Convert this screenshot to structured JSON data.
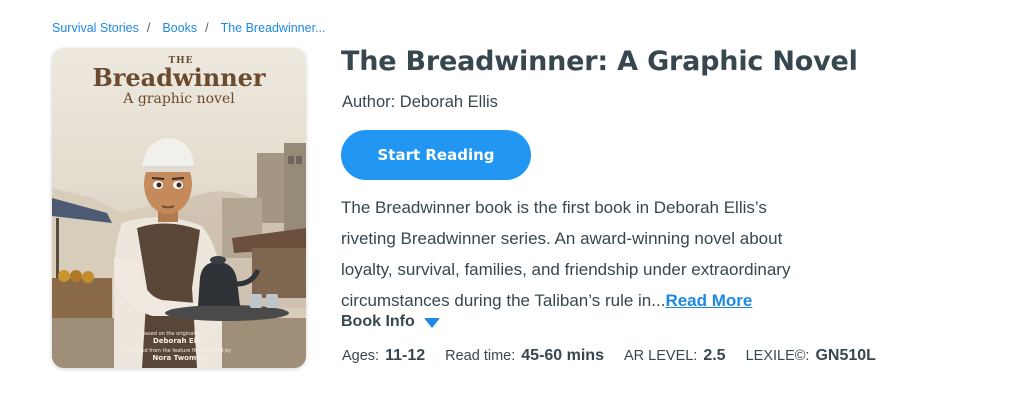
{
  "breadcrumb": [
    {
      "label": "Survival Stories"
    },
    {
      "label": "Books"
    },
    {
      "label": "The Breadwinner..."
    }
  ],
  "cover": {
    "title_small": "THE",
    "title_big": "Breadwinner",
    "subtitle": "A graphic novel",
    "credit_line1": "Based on the original book by",
    "credit_author": "Deborah Ellis",
    "credit_line2": "Adapted from the feature film directed by",
    "credit_director": "Nora Twomey"
  },
  "book": {
    "title": "The Breadwinner: A Graphic Novel",
    "author": "Author: Deborah Ellis",
    "start_label": "Start Reading",
    "description": "The Breadwinner book is the first book in Deborah Ellis’s riveting Breadwinner series. An award-winning novel about loyalty, survival, families, and friendship under extraordinary circumstances during the Taliban’s rule in...",
    "read_more": "Read More",
    "info_label": "Book Info"
  },
  "meta": {
    "ages_label": "Ages:",
    "ages": "11-12",
    "read_label": "Read time:",
    "read": "45-60 mins",
    "ar_label": "AR LEVEL:",
    "ar": "2.5",
    "lexile_label": "LEXILE©:",
    "lexile": "GN510L"
  },
  "colors": {
    "accent": "#2196f3",
    "link": "#1e88e5",
    "text": "#37474f"
  }
}
